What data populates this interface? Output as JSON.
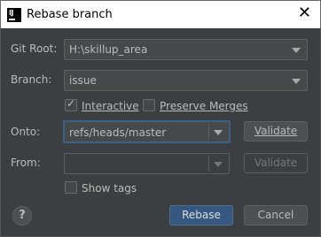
{
  "window": {
    "title": "Rebase branch",
    "close_glyph": "✕",
    "app_icon": "intellij-icon"
  },
  "git_root": {
    "label": "Git Root:",
    "value": "H:\\skillup_area"
  },
  "branch": {
    "label": "Branch:",
    "value": "issue"
  },
  "options": {
    "interactive": {
      "label": "Interactive",
      "checked": true
    },
    "preserve_merges": {
      "label": "Preserve Merges",
      "checked": false
    }
  },
  "onto": {
    "label": "Onto:",
    "value": "refs/heads/master",
    "validate_label": "Validate"
  },
  "from": {
    "label": "From:",
    "value": "",
    "validate_label": "Validate"
  },
  "show_tags": {
    "label": "Show tags",
    "checked": false
  },
  "footer": {
    "help_glyph": "?",
    "rebase_label": "Rebase",
    "cancel_label": "Cancel"
  },
  "colors": {
    "background": "#3c3f41",
    "accent": "#365880",
    "focus_border": "#3d6185",
    "titlebar": "#ffffff"
  }
}
